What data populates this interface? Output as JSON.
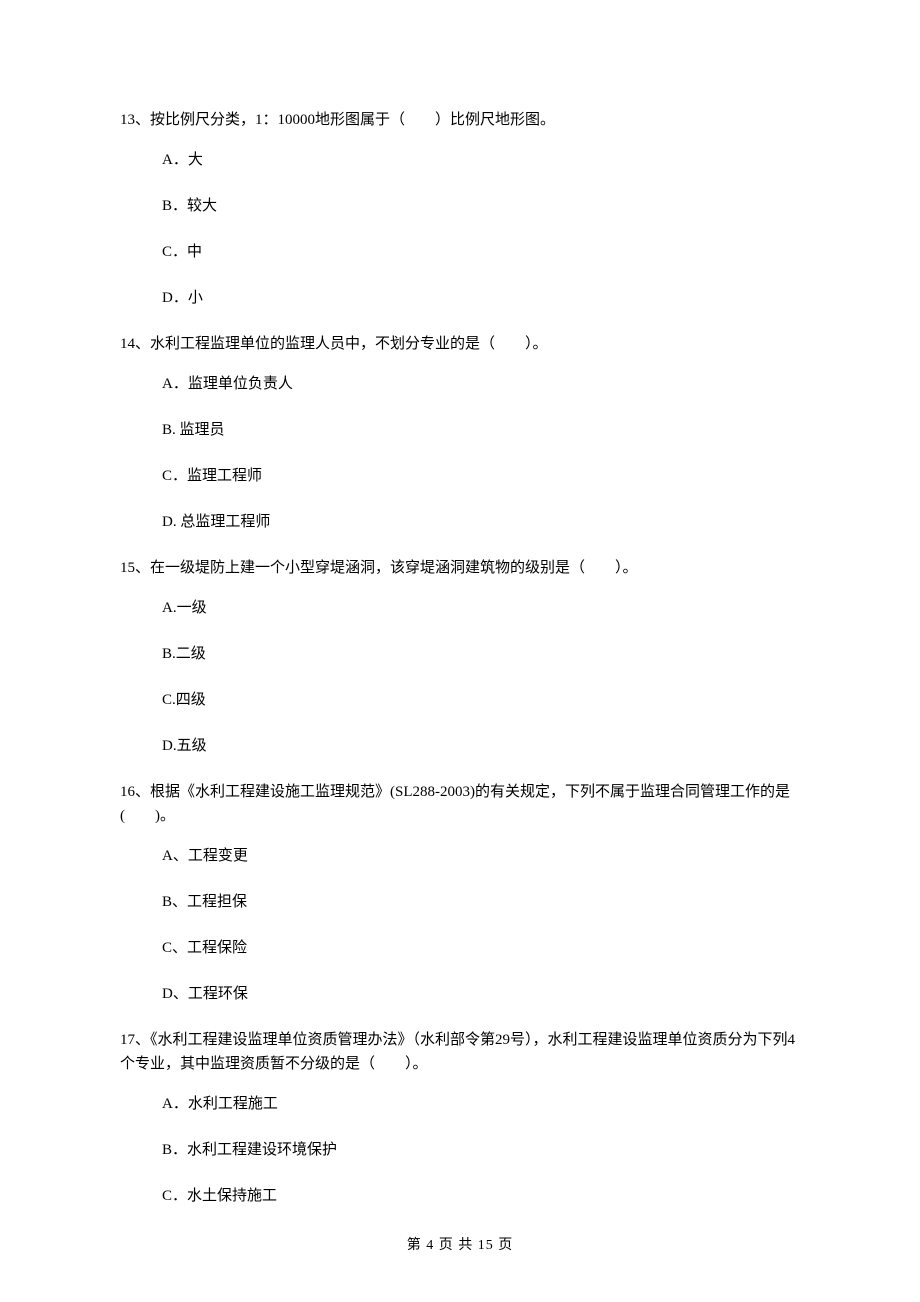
{
  "questions": [
    {
      "stem": "13、按比例尺分类，1：10000地形图属于（　　）比例尺地形图。",
      "options": [
        "A．大",
        "B．较大",
        "C．中",
        "D．小"
      ]
    },
    {
      "stem": "14、水利工程监理单位的监理人员中，不划分专业的是（　　）。",
      "options": [
        "A．监理单位负责人",
        "B. 监理员",
        "C．监理工程师",
        "D. 总监理工程师"
      ]
    },
    {
      "stem": "15、在一级堤防上建一个小型穿堤涵洞，该穿堤涵洞建筑物的级别是（　　）。",
      "options": [
        "A.一级",
        "B.二级",
        "C.四级",
        "D.五级"
      ]
    },
    {
      "stem": "16、根据《水利工程建设施工监理规范》(SL288-2003)的有关规定，下列不属于监理合同管理工作的是(　　)。",
      "options": [
        "A、工程变更",
        "B、工程担保",
        "C、工程保险",
        "D、工程环保"
      ]
    },
    {
      "stem": "17、《水利工程建设监理单位资质管理办法》（水利部令第29号），水利工程建设监理单位资质分为下列4个专业，其中监理资质暂不分级的是（　　）。",
      "options": [
        "A．水利工程施工",
        "B．水利工程建设环境保护",
        "C．水土保持施工"
      ]
    }
  ],
  "footer": "第 4 页 共 15 页"
}
